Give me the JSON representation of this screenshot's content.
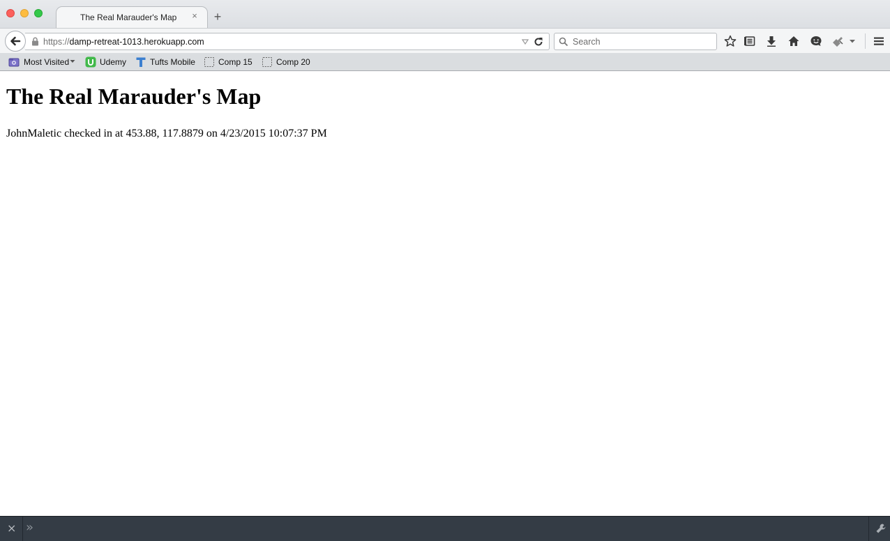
{
  "browser": {
    "tab": {
      "title": "The Real Marauder's Map",
      "close_glyph": "×"
    },
    "new_tab_glyph": "+",
    "url": {
      "scheme": "https://",
      "host": "damp-retreat-1013.herokuapp.com"
    },
    "search": {
      "placeholder": "Search"
    },
    "bookmarks": [
      {
        "label": "Most Visited",
        "icon": "most-visited-icon"
      },
      {
        "label": "Udemy",
        "icon": "udemy-icon"
      },
      {
        "label": "Tufts Mobile",
        "icon": "tufts-icon"
      },
      {
        "label": "Comp 15",
        "icon": "folder-icon"
      },
      {
        "label": "Comp 20",
        "icon": "folder-icon"
      }
    ],
    "toolbar_icons": [
      "star-icon",
      "reader-list-icon",
      "download-icon",
      "home-icon",
      "hello-icon",
      "extension-icon",
      "menu-icon"
    ]
  },
  "page": {
    "heading": "The Real Marauder's Map",
    "checkin_text": "JohnMaletic checked in at 453.88, 117.8879 on 4/23/2015 10:07:37 PM"
  },
  "devtools": {
    "close_glyph": "×",
    "expand_glyph": "»"
  },
  "colors": {
    "traffic_close": "#fc605c",
    "traffic_min": "#fdbc40",
    "traffic_max": "#34c84a",
    "devbar": "#343c45",
    "udemy_green": "#41b94a",
    "tufts_blue": "#3b7fd0"
  }
}
